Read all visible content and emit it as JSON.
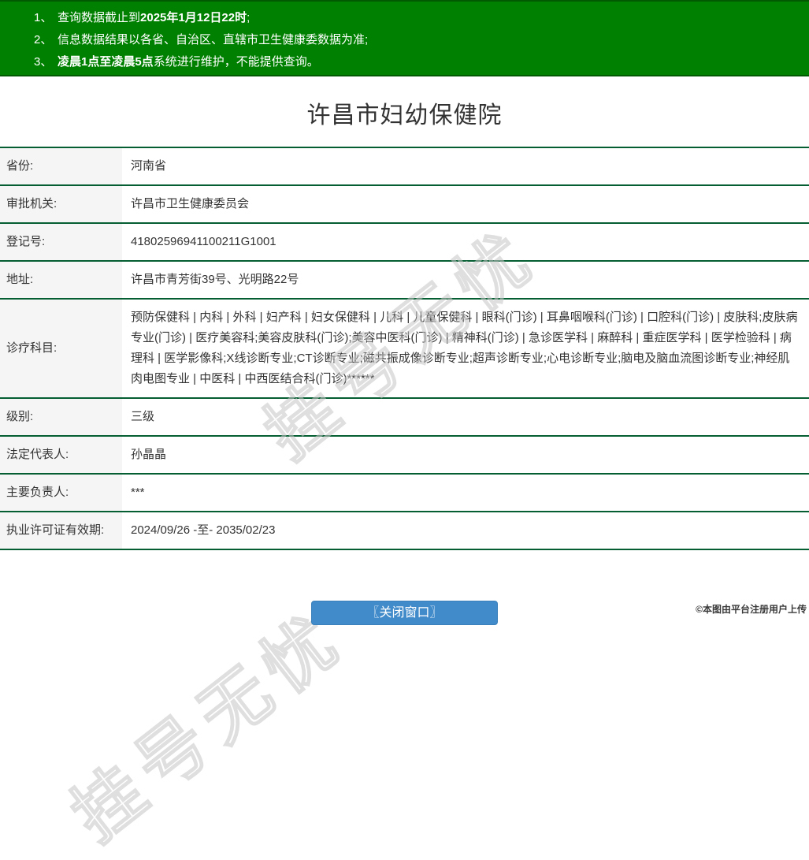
{
  "banner": {
    "notices": [
      {
        "num": "1、",
        "pre": "查询数据截止到",
        "bold": "2025年1月12日22时",
        "post": ";"
      },
      {
        "num": "2、",
        "pre": "信息数据结果以各省、自治区、直辖市卫生健康委数据为准;",
        "bold": "",
        "post": ""
      },
      {
        "num": "3、",
        "pre": "",
        "bold": "凌晨1点至凌晨5点",
        "post": "系统进行维护，不能提供查询。"
      }
    ]
  },
  "page": {
    "title": "许昌市妇幼保健院"
  },
  "table": {
    "rows": [
      {
        "label": "省份:",
        "value": "河南省"
      },
      {
        "label": "审批机关:",
        "value": "许昌市卫生健康委员会"
      },
      {
        "label": "登记号:",
        "value": "41802596941100211G1001"
      },
      {
        "label": "地址:",
        "value": "许昌市青芳街39号、光明路22号"
      },
      {
        "label": "诊疗科目:",
        "value": "预防保健科 | 内科 | 外科 | 妇产科 | 妇女保健科 | 儿科 | 儿童保健科 | 眼科(门诊) | 耳鼻咽喉科(门诊) | 口腔科(门诊) | 皮肤科;皮肤病专业(门诊) | 医疗美容科;美容皮肤科(门诊);美容中医科(门诊) | 精神科(门诊) | 急诊医学科 | 麻醉科 | 重症医学科 | 医学检验科 | 病理科 | 医学影像科;X线诊断专业;CT诊断专业;磁共振成像诊断专业;超声诊断专业;心电诊断专业;脑电及脑血流图诊断专业;神经肌肉电图专业 | 中医科 | 中西医结合科(门诊)******"
      },
      {
        "label": "级别:",
        "value": "三级"
      },
      {
        "label": "法定代表人:",
        "value": "孙晶晶"
      },
      {
        "label": "主要负责人:",
        "value": "***"
      },
      {
        "label": "执业许可证有效期:",
        "value": "2024/09/26 -至- 2035/02/23"
      }
    ]
  },
  "watermark": {
    "text": "挂号无忧"
  },
  "footer": {
    "close_label": "〖关闭窗口〗",
    "copyright": "©本图由平台注册用户上传"
  },
  "colors": {
    "banner_green": "#008000",
    "divider_green": "#055e31",
    "label_bg": "#f5f5f5",
    "button_blue": "#428bca",
    "text": "#333333"
  }
}
